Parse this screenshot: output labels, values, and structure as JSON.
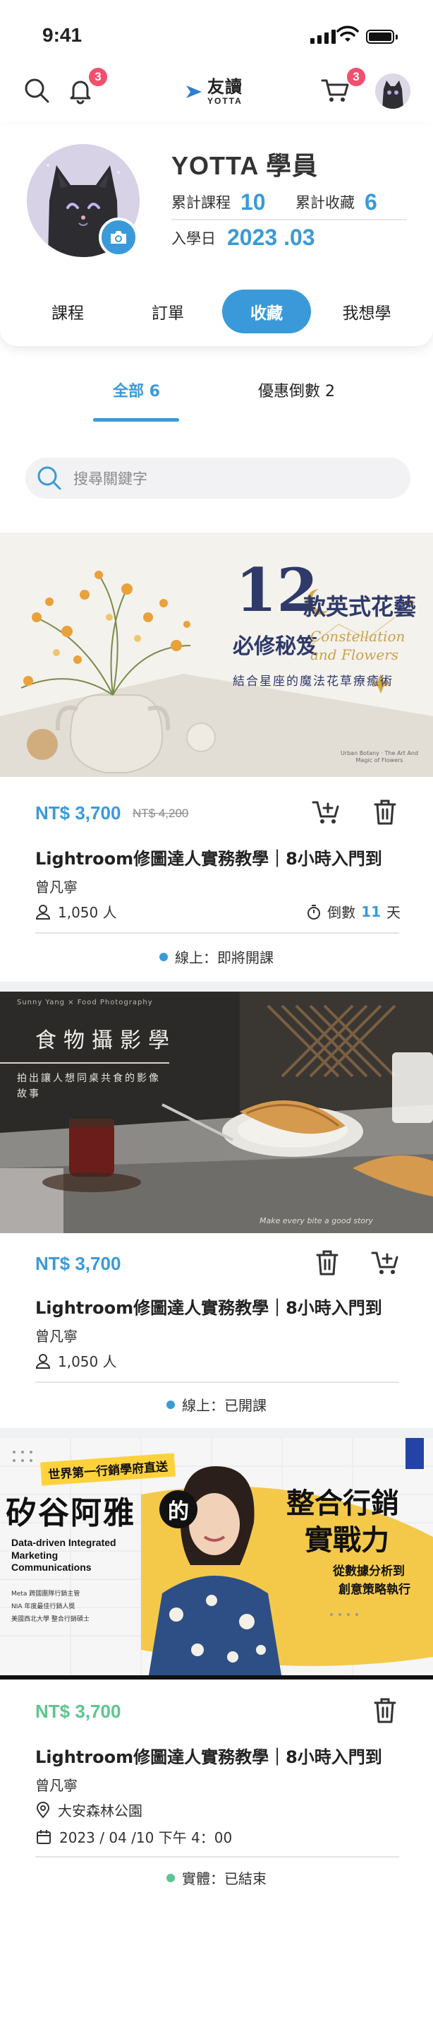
{
  "status_bar": {
    "time": "9:41"
  },
  "header": {
    "notification_count": "3",
    "cart_count": "3",
    "logo_main": "友讀",
    "logo_sub": "YOTTA"
  },
  "profile": {
    "name": "YOTTA 學員",
    "courses_label": "累計課程",
    "courses_value": "10",
    "favorites_label": "累計收藏",
    "favorites_value": "6",
    "enroll_label": "入學日",
    "enroll_value": "2023 .03",
    "tabs": [
      "課程",
      "訂單",
      "收藏",
      "我想學"
    ],
    "active_tab": "收藏"
  },
  "filter_tabs": [
    {
      "label": "全部 6",
      "active": true
    },
    {
      "label": "優惠倒數 2",
      "active": false
    }
  ],
  "search": {
    "placeholder": "搜尋關鍵字"
  },
  "colors": {
    "accent": "#3a9ad9",
    "badge": "#f0506e",
    "physical": "#5cc690"
  },
  "cards": [
    {
      "banner_title": "款英式花藝",
      "banner_number": "12",
      "banner_subtitle": "必修秘笈",
      "banner_tagline": "結合星座的魔法花草療癒術",
      "banner_script": "Constellation and Flowers",
      "banner_caption": "Urban Botany · The Art And Magic of Flowers",
      "price": "NT$ 3,700",
      "old_price": "NT$ 4,200",
      "title": "Lightroom修圖達人實務教學｜8小時入門到",
      "author": "曾凡寧",
      "students": "1,050 人",
      "countdown_prefix": "倒數",
      "countdown_days": "11",
      "countdown_suffix": "天",
      "status": "線上：即將開課"
    },
    {
      "banner_title": "食物攝影學",
      "banner_tagline": "拍出讓人想同桌共食的影像故事",
      "banner_top": "Sunny Yang × Food Photography",
      "banner_bottom": "Make every bite a good story",
      "price": "NT$ 3,700",
      "title": "Lightroom修圖達人實務教學｜8小時入門到",
      "author": "曾凡寧",
      "students": "1,050 人",
      "status": "線上：已開課"
    },
    {
      "banner_kicker": "世界第一行銷學府直送",
      "banner_name": "矽谷阿雅",
      "banner_of": "的",
      "banner_title_line1": "整合行銷",
      "banner_title_line2": "實戰力",
      "banner_eng": "Data-driven Integrated Marketing Communications",
      "banner_sub1": "從數據分析到",
      "banner_sub2": "創意策略執行",
      "banner_points": [
        "Meta 跨國團隊行銷主管",
        "NIA 年度最佳行銷人獎",
        "美國西北大學 整合行銷碩士"
      ],
      "price": "NT$ 3,700",
      "title": "Lightroom修圖達人實務教學｜8小時入門到",
      "author": "曾凡寧",
      "location": "大安森林公園",
      "datetime": "2023 / 04 /10 下午 4：00",
      "status": "實體：已結束"
    }
  ]
}
